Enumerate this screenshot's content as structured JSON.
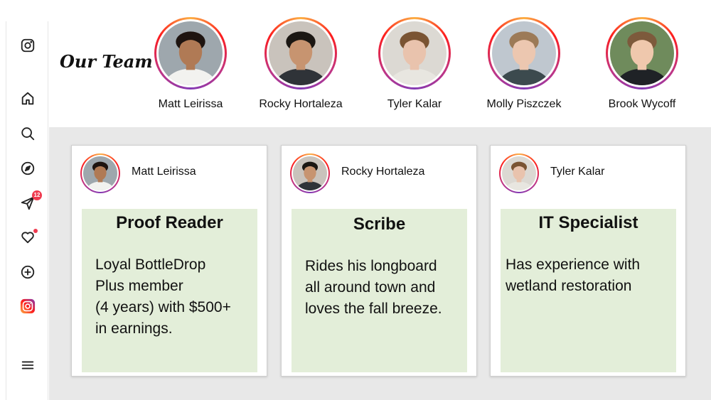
{
  "header": {
    "title": "Our Team"
  },
  "team": [
    {
      "name": "Matt Leirissa",
      "skin": "#b07a55",
      "hair": "#1e1410",
      "bg": "#9ea7ad",
      "shirt": "#f2f2ef"
    },
    {
      "name": "Rocky Hortaleza",
      "skin": "#c79470",
      "hair": "#1b1713",
      "bg": "#c9c3bc",
      "shirt": "#2f3338"
    },
    {
      "name": "Tyler Kalar",
      "skin": "#e9c3ad",
      "hair": "#7a5433",
      "bg": "#dcd9d3",
      "shirt": "#e8e6e0"
    },
    {
      "name": "Molly Piszczek",
      "skin": "#ecc7b0",
      "hair": "#9c7a57",
      "bg": "#bfc7cf",
      "shirt": "#3c4a4e"
    },
    {
      "name": "Brook Wycoff",
      "skin": "#efc8ad",
      "hair": "#7d5a3c",
      "bg": "#6f8b5c",
      "shirt": "#1f2226"
    }
  ],
  "cards": [
    {
      "name": "Matt Leirissa",
      "role": "Proof Reader",
      "description": "Loyal BottleDrop\nPlus member\n(4 years) with $500+\nin earnings."
    },
    {
      "name": "Rocky Hortaleza",
      "role": "Scribe",
      "description": "Rides his longboard\nall around town and\nloves the fall breeze."
    },
    {
      "name": "Tyler Kalar",
      "role": "IT Specialist",
      "description": "Has experience with\nwetland restoration"
    }
  ],
  "sidebar": {
    "items": [
      {
        "icon": "instagram-logo-icon"
      },
      {
        "icon": "home-icon"
      },
      {
        "icon": "search-icon"
      },
      {
        "icon": "explore-icon"
      },
      {
        "icon": "messages-icon",
        "badge": "12"
      },
      {
        "icon": "notifications-heart-icon"
      },
      {
        "icon": "create-icon"
      },
      {
        "icon": "profile-icon"
      },
      {
        "icon": "menu-icon"
      }
    ]
  },
  "colors": {
    "card_body": "#e3eed9",
    "content_bg": "#e8e8e8",
    "badge": "#ef3a4f"
  }
}
